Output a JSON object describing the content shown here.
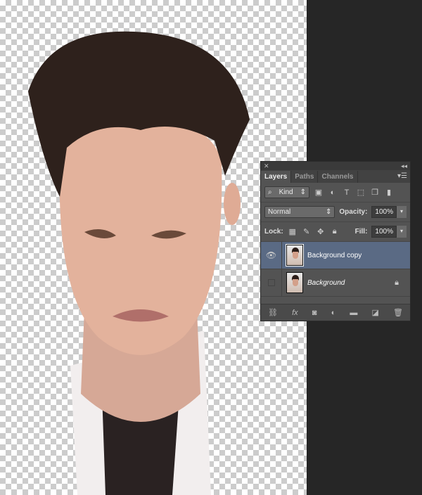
{
  "panel": {
    "tabs": [
      {
        "label": "Layers"
      },
      {
        "label": "Paths"
      },
      {
        "label": "Channels"
      }
    ],
    "filter": {
      "label": "Kind"
    },
    "blend_mode": "Normal",
    "opacity_label": "Opacity:",
    "opacity": "100%",
    "lock_label": "Lock:",
    "fill_label": "Fill:",
    "fill": "100%",
    "layers": [
      {
        "name": "Background copy",
        "visible": true,
        "selected": true
      },
      {
        "name": "Background",
        "visible": false,
        "selected": false,
        "locked": true
      }
    ]
  }
}
